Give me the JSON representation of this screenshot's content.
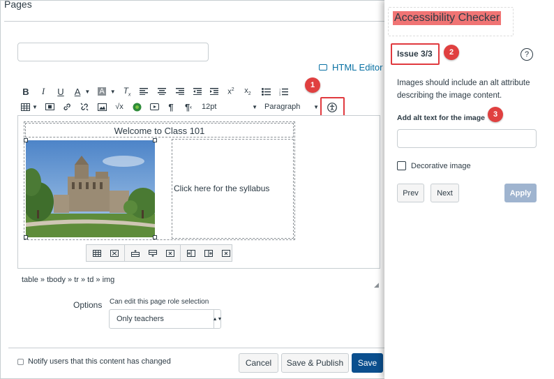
{
  "page": {
    "title": "Pages"
  },
  "editor": {
    "html_editor_label": "HTML Editor",
    "toolbar": {
      "font_size": "12pt",
      "block_format": "Paragraph"
    },
    "content": {
      "table_heading": "Welcome to Class 101",
      "syllabus_link": "Click here for the syllabus"
    },
    "path": "table » tbody » tr » td » img"
  },
  "options": {
    "label": "Options",
    "role_label": "Can edit this page role selection",
    "role_value": "Only teachers"
  },
  "footer": {
    "notify_label": "Notify users that this content has changed",
    "cancel_label": "Cancel",
    "save_publish_label": "Save & Publish",
    "save_label": "Save"
  },
  "checker": {
    "title": "Accessibility Checker",
    "issue": "Issue 3/3",
    "help_icon_glyph": "?",
    "description": "Images should include an alt attribute describing the image content.",
    "alt_label": "Add alt text for the image",
    "alt_value": "",
    "decorative_label": "Decorative image",
    "prev_label": "Prev",
    "next_label": "Next",
    "apply_label": "Apply"
  },
  "callouts": {
    "one": "1",
    "two": "2",
    "three": "3"
  },
  "colors": {
    "primary": "#0b4f8e",
    "link": "#0770a3",
    "callout": "#e04040",
    "highlight": "#f07474",
    "apply_disabled": "#9fb4cf"
  }
}
